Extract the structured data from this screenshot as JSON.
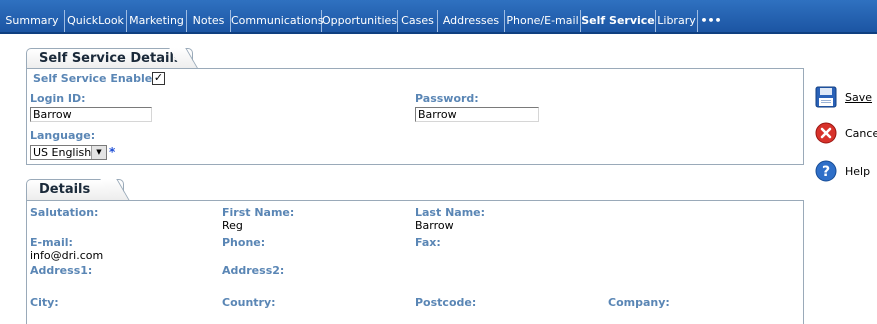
{
  "tabs": [
    {
      "label": "Summary",
      "active": false
    },
    {
      "label": "QuickLook",
      "active": false
    },
    {
      "label": "Marketing",
      "active": false
    },
    {
      "label": "Notes",
      "active": false
    },
    {
      "label": "Communications",
      "active": false
    },
    {
      "label": "Opportunities",
      "active": false
    },
    {
      "label": "Cases",
      "active": false
    },
    {
      "label": "Addresses",
      "active": false
    },
    {
      "label": "Phone/E-mail",
      "active": false
    },
    {
      "label": "Self Service",
      "active": true
    },
    {
      "label": "Library",
      "active": false
    },
    {
      "label": "•••",
      "active": false
    }
  ],
  "self_service": {
    "section_title": "Self Service Details",
    "enabled_label": "Self Service Enabled",
    "enabled": true,
    "login_label": "Login ID:",
    "login_value": "Barrow",
    "password_label": "Password:",
    "password_value": "Barrow",
    "language_label": "Language:",
    "language_value": "US English",
    "required_marker": "*"
  },
  "details": {
    "section_title": "Details",
    "salutation_label": "Salutation:",
    "first_name_label": "First Name:",
    "first_name_value": "Reg",
    "last_name_label": "Last Name:",
    "last_name_value": "Barrow",
    "email_label": "E-mail:",
    "email_value": "info@dri.com",
    "phone_label": "Phone:",
    "fax_label": "Fax:",
    "address1_label": "Address1:",
    "address2_label": "Address2:",
    "city_label": "City:",
    "country_label": "Country:",
    "postcode_label": "Postcode:",
    "company_label": "Company:"
  },
  "actions": {
    "save_label": "Save",
    "cancel_label": "Cance",
    "help_label": "Help"
  },
  "colors": {
    "tabbar": "#1f5aa8",
    "label_blue": "#5a86b5",
    "required_blue": "#1f4fd6"
  }
}
